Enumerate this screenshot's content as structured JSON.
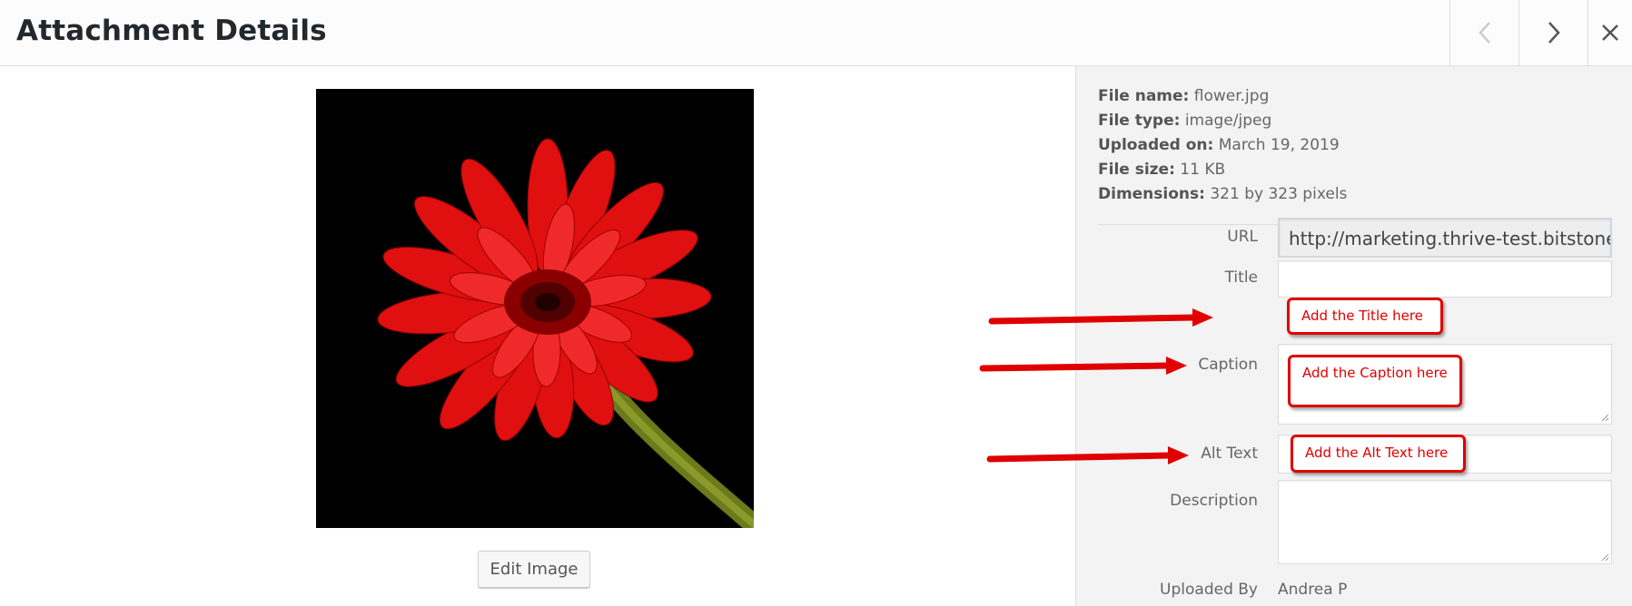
{
  "header": {
    "title": "Attachment Details"
  },
  "icons": {
    "prev": "chevron-left-icon",
    "next": "chevron-right-icon",
    "close": "close-icon"
  },
  "media": {
    "edit_button_label": "Edit Image"
  },
  "file_info": [
    {
      "label": "File name:",
      "value": "flower.jpg"
    },
    {
      "label": "File type:",
      "value": "image/jpeg"
    },
    {
      "label": "Uploaded on:",
      "value": "March 19, 2019"
    },
    {
      "label": "File size:",
      "value": "11 KB"
    },
    {
      "label": "Dimensions:",
      "value": "321 by 323 pixels"
    }
  ],
  "fields": {
    "url": {
      "label": "URL",
      "value": "http://marketing.thrive-test.bitstoneint"
    },
    "title": {
      "label": "Title",
      "value": ""
    },
    "caption": {
      "label": "Caption",
      "value": ""
    },
    "alt_text": {
      "label": "Alt Text",
      "value": ""
    },
    "description": {
      "label": "Description",
      "value": ""
    },
    "uploaded_by": {
      "label": "Uploaded By",
      "value": "Andrea P"
    }
  },
  "annotations": {
    "title_note": "Add the Title here",
    "caption_note": "Add the Caption here",
    "alt_note": "Add the Alt Text here"
  },
  "colors": {
    "annotation_red": "#e00000",
    "sidebar_bg": "#f3f3f3",
    "header_bg": "#fcfcfc"
  }
}
